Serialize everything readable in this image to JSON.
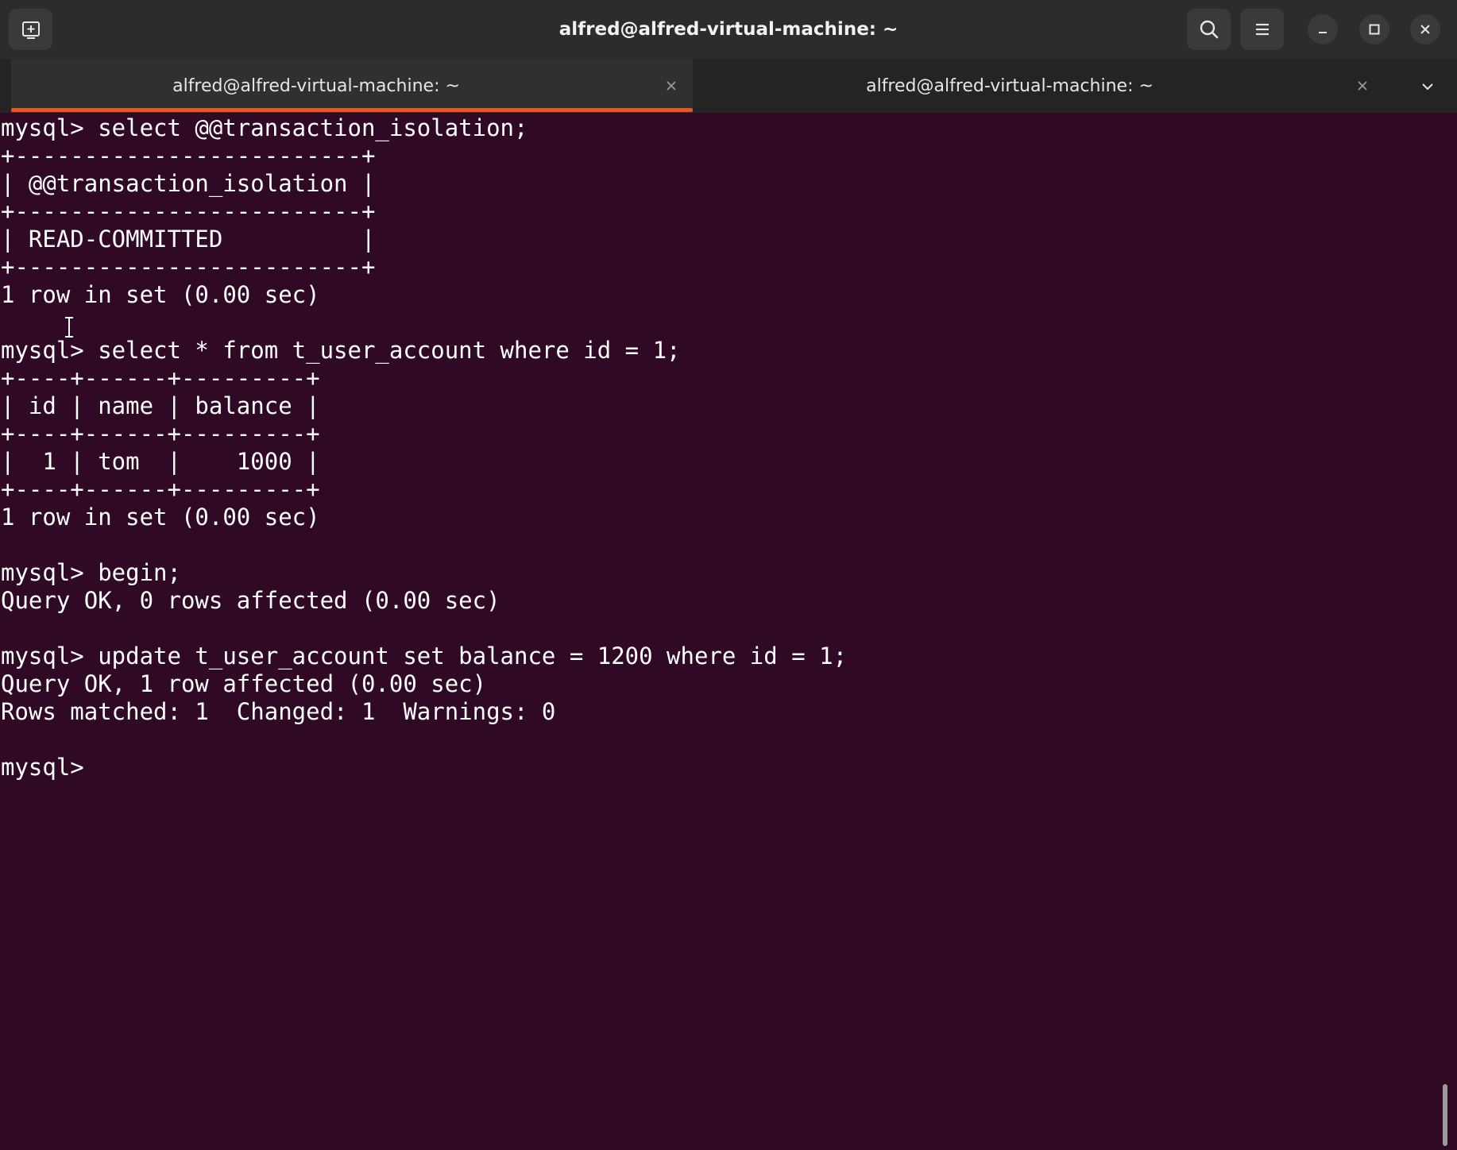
{
  "window": {
    "title": "alfred@alfred-virtual-machine: ~"
  },
  "tabs": [
    {
      "label": "alfred@alfred-virtual-machine: ~",
      "active": true
    },
    {
      "label": "alfred@alfred-virtual-machine: ~",
      "active": false
    }
  ],
  "icons": {
    "new_tab": "new-tab-icon",
    "search": "search-icon",
    "menu": "hamburger-menu-icon",
    "minimize": "minimize-icon",
    "maximize": "maximize-icon",
    "close": "close-icon",
    "tab_close": "tab-close-icon",
    "tabs_dropdown": "chevron-down-icon"
  },
  "colors": {
    "terminal_bg": "#300a24",
    "accent": "#e95420",
    "text": "#ffffff"
  },
  "terminal": {
    "lines": [
      "mysql> select @@transaction_isolation;",
      "+-------------------------+",
      "| @@transaction_isolation |",
      "+-------------------------+",
      "| READ-COMMITTED          |",
      "+-------------------------+",
      "1 row in set (0.00 sec)",
      "",
      "mysql> select * from t_user_account where id = 1;",
      "+----+------+---------+",
      "| id | name | balance |",
      "+----+------+---------+",
      "|  1 | tom  |    1000 |",
      "+----+------+---------+",
      "1 row in set (0.00 sec)",
      "",
      "mysql> begin;",
      "Query OK, 0 rows affected (0.00 sec)",
      "",
      "mysql> update t_user_account set balance = 1200 where id = 1;",
      "Query OK, 1 row affected (0.00 sec)",
      "Rows matched: 1  Changed: 1  Warnings: 0",
      "",
      "mysql> "
    ]
  }
}
